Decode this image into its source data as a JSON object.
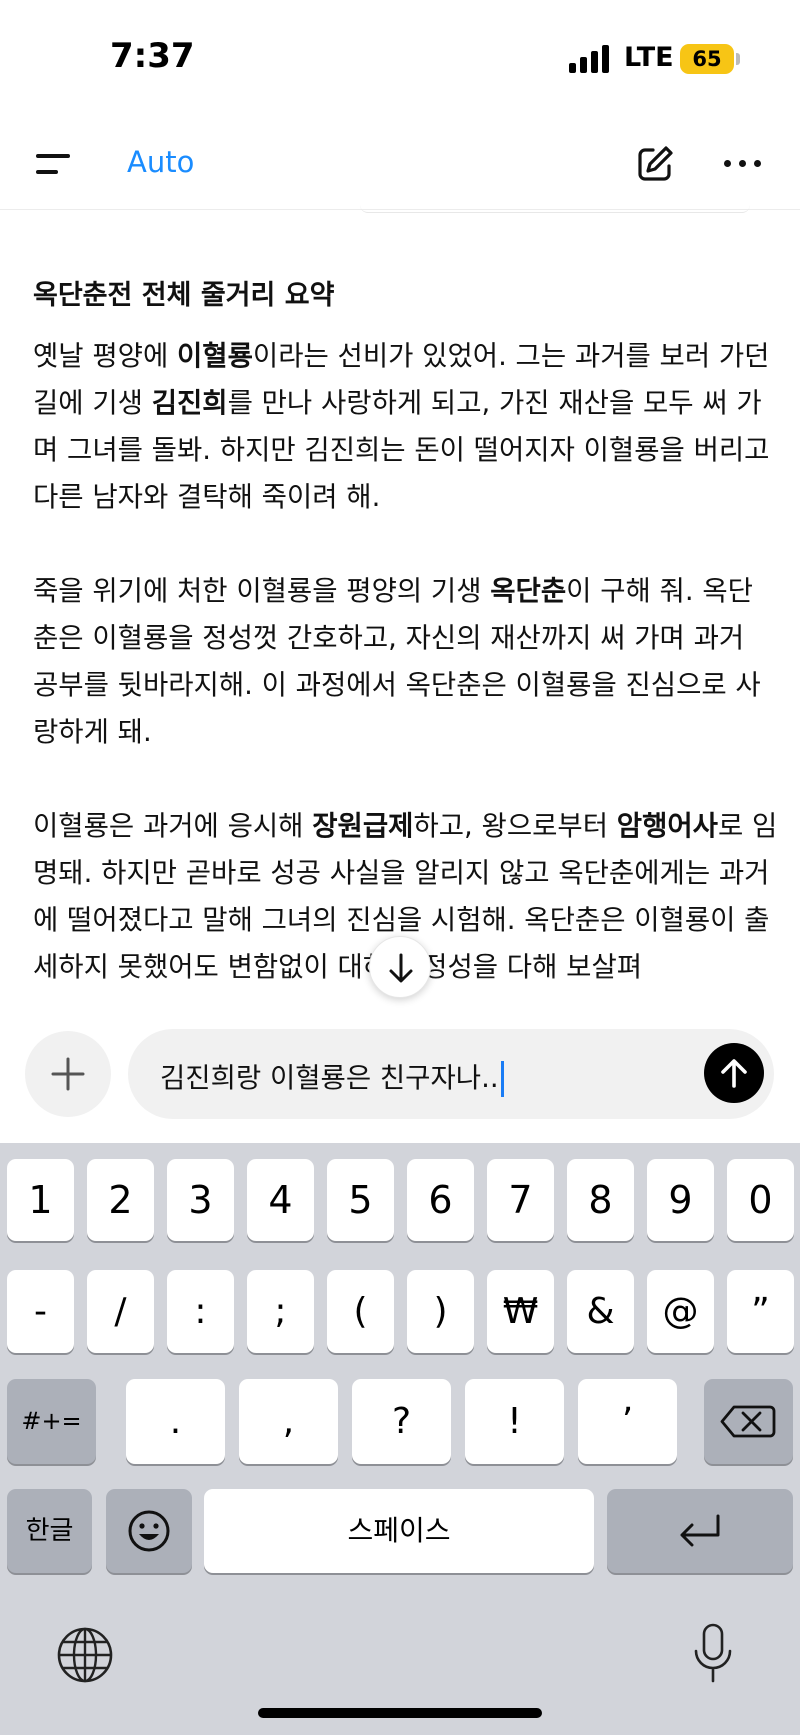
{
  "status_bar": {
    "time": "7:37",
    "network": "LTE",
    "battery": "65"
  },
  "header": {
    "model_label": "Auto"
  },
  "colors": {
    "accent": "#1a8cff",
    "battery": "#f7c515",
    "caret": "#1a7cf5"
  },
  "content": {
    "heading": "옥단춘전 전체 줄거리 요약",
    "paragraphs": [
      [
        {
          "t": "옛날 평양에 "
        },
        {
          "t": "이혈룡",
          "b": true
        },
        {
          "t": "이라는 선비가 있었어. 그는 과거를 보러 가던 길에 기생 "
        },
        {
          "t": "김진희",
          "b": true
        },
        {
          "t": "를 만나 사랑하게 되고, 가진 재산을 모두 써 가며 그녀를 돌봐. 하지만 김진희는 돈이 떨어지자 이혈룡을 버리고 다른 남자와 결탁해 죽이려 해."
        }
      ],
      [
        {
          "t": "죽을 위기에 처한 이혈룡을 평양의 기생 "
        },
        {
          "t": "옥단춘",
          "b": true
        },
        {
          "t": "이 구해 줘. 옥단춘은 이혈룡을 정성껏 간호하고, 자신의 재산까지 써 가며 과거 공부를 뒷바라지해. 이 과정에서 옥단춘은 이혈룡을 진심으로 사랑하게 돼."
        }
      ],
      [
        {
          "t": "이혈룡은 과거에 응시해 "
        },
        {
          "t": "장원급제",
          "b": true
        },
        {
          "t": "하고, 왕으로부터 "
        },
        {
          "t": "암행어사",
          "b": true
        },
        {
          "t": "로 임명돼. 하지만 곧바로 성공 사실을 알리지 않고 옥단춘에게는 과거에 떨어졌다고 말해 그녀의 진심을 시험해. 옥단춘은 이혈룡이 출세하지 못했어도 변함없이 대하며 정성을 다해 보살펴"
        }
      ]
    ]
  },
  "composer": {
    "text": "김진희랑 이혈룡은 친구자나.."
  },
  "keyboard": {
    "row1": [
      "1",
      "2",
      "3",
      "4",
      "5",
      "6",
      "7",
      "8",
      "9",
      "0"
    ],
    "row2": [
      "-",
      "/",
      ":",
      ";",
      "(",
      ")",
      "₩",
      "&",
      "@",
      "”"
    ],
    "row3": {
      "mode": "#+=",
      "keys": [
        ".",
        ",",
        "?",
        "!",
        "’"
      ]
    },
    "row4": {
      "lang": "한글",
      "space": "스페이스"
    }
  }
}
